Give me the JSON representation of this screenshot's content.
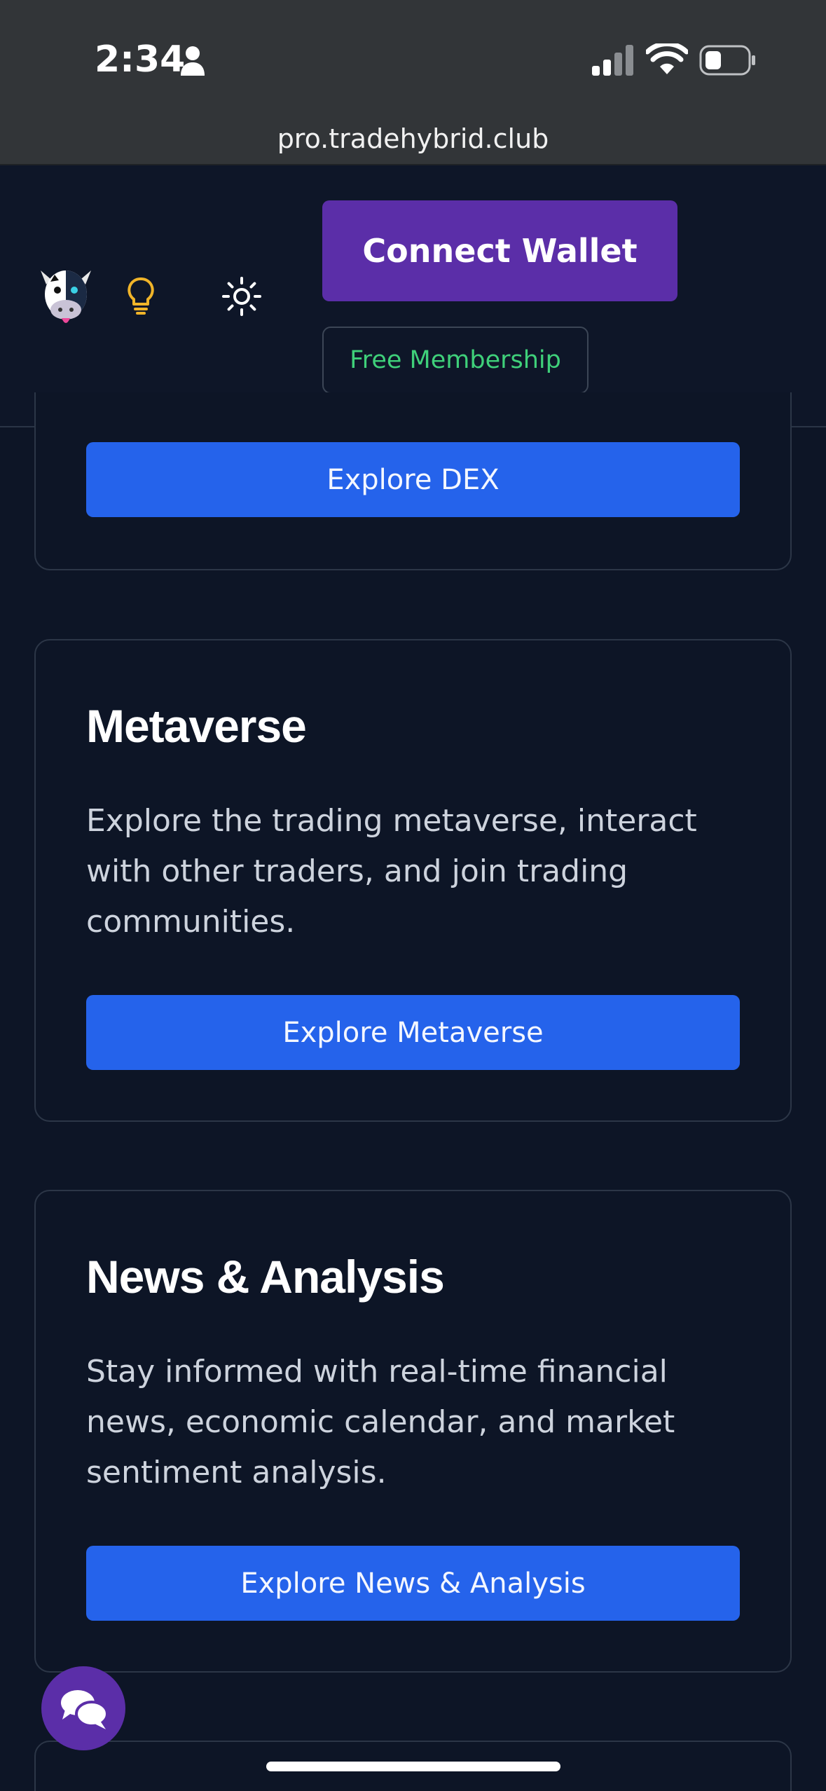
{
  "status_bar": {
    "time": "2:34"
  },
  "browser": {
    "url": "pro.tradehybrid.club"
  },
  "header": {
    "connect_wallet_label": "Connect Wallet",
    "free_membership_label": "Free Membership"
  },
  "cards": [
    {
      "button_label": "Explore DEX"
    },
    {
      "title": "Metaverse",
      "description": "Explore the trading metaverse, interact with other traders, and join trading communities.",
      "button_label": "Explore Metaverse"
    },
    {
      "title": "News & Analysis",
      "description": "Stay informed with real-time financial news, economic calendar, and market sentiment analysis.",
      "button_label": "Explore News & Analysis"
    }
  ],
  "colors": {
    "background": "#0d1526",
    "primary_button": "#2563eb",
    "accent_purple": "#5b2ea8",
    "membership_green": "#3fd07a",
    "bulb_yellow": "#f0b429"
  }
}
